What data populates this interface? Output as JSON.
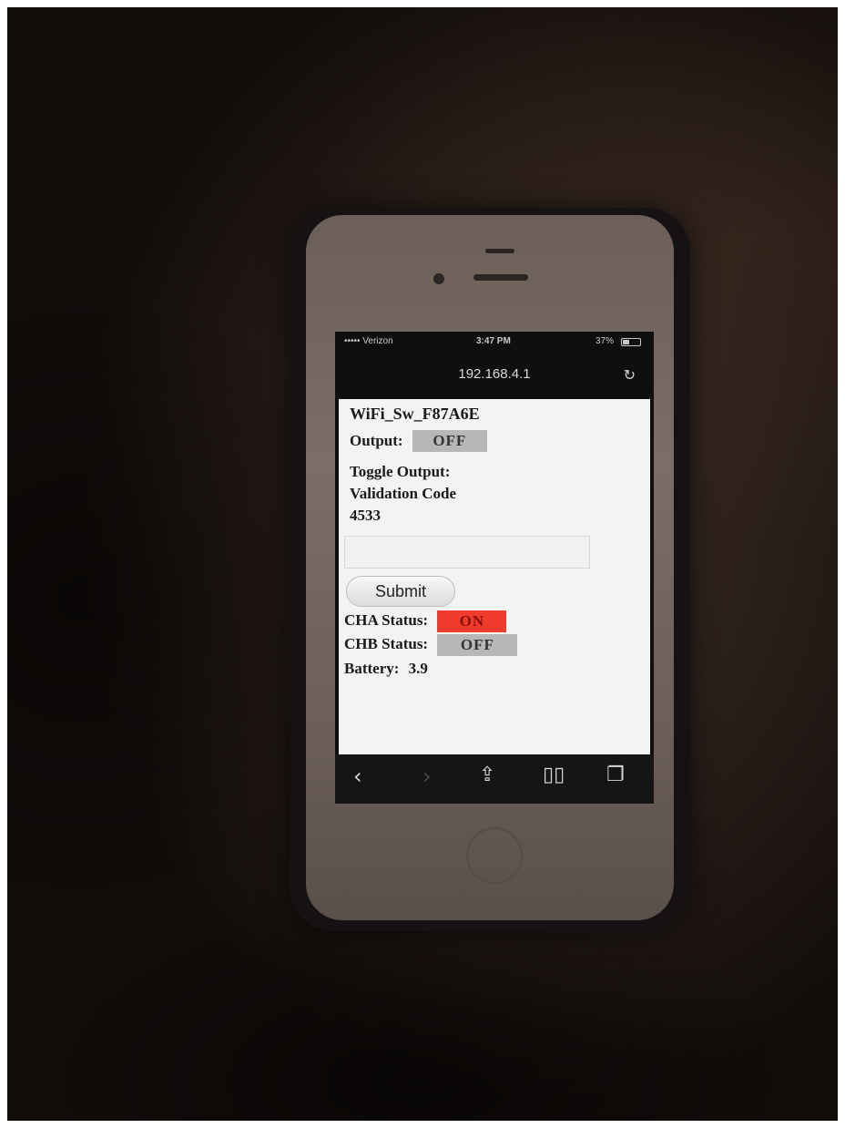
{
  "status_bar": {
    "carrier": "••••• Verizon",
    "time": "3:47 PM",
    "battery_percent": "37%"
  },
  "browser": {
    "url": "192.168.4.1",
    "reload_icon": "reload-icon"
  },
  "page": {
    "device_title": "WiFi_Sw_F87A6E",
    "output_label": "Output:",
    "output_value": "OFF",
    "toggle_label": "Toggle Output:",
    "validation_label": "Validation Code",
    "validation_code": "4533",
    "code_input": {
      "value": "",
      "placeholder": ""
    },
    "submit_label": "Submit",
    "cha_label": "CHA Status:",
    "cha_value": "ON",
    "chb_label": "CHB Status:",
    "chb_value": "OFF",
    "battery_label": "Battery:",
    "battery_value": "3.9"
  },
  "toolbar": {
    "back_icon": "chevron-left-icon",
    "forward_icon": "chevron-right-icon",
    "share_icon": "share-icon",
    "bookmarks_icon": "book-icon",
    "tabs_icon": "tabs-icon"
  },
  "colors": {
    "status_on": "#ef3b2c",
    "status_off": "#b7b7b7"
  }
}
